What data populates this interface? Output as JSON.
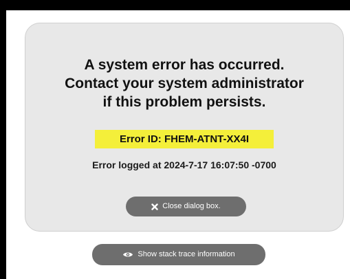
{
  "dialog": {
    "message_line1": "A system error has occurred.",
    "message_line2": "Contact your system administrator",
    "message_line3": "if this problem persists.",
    "error_id": "Error ID: FHEM-ATNT-XX4I",
    "logged_at": "Error logged at 2024-7-17 16:07:50 -0700",
    "close_label": "Close dialog box.",
    "close_icon": "x-icon"
  },
  "stack": {
    "label": "Show stack trace information",
    "icon": "eye-icon"
  },
  "colors": {
    "highlight": "#f4ef3a",
    "button": "#6e6e6e",
    "dialog_bg": "#e8e8e8"
  }
}
